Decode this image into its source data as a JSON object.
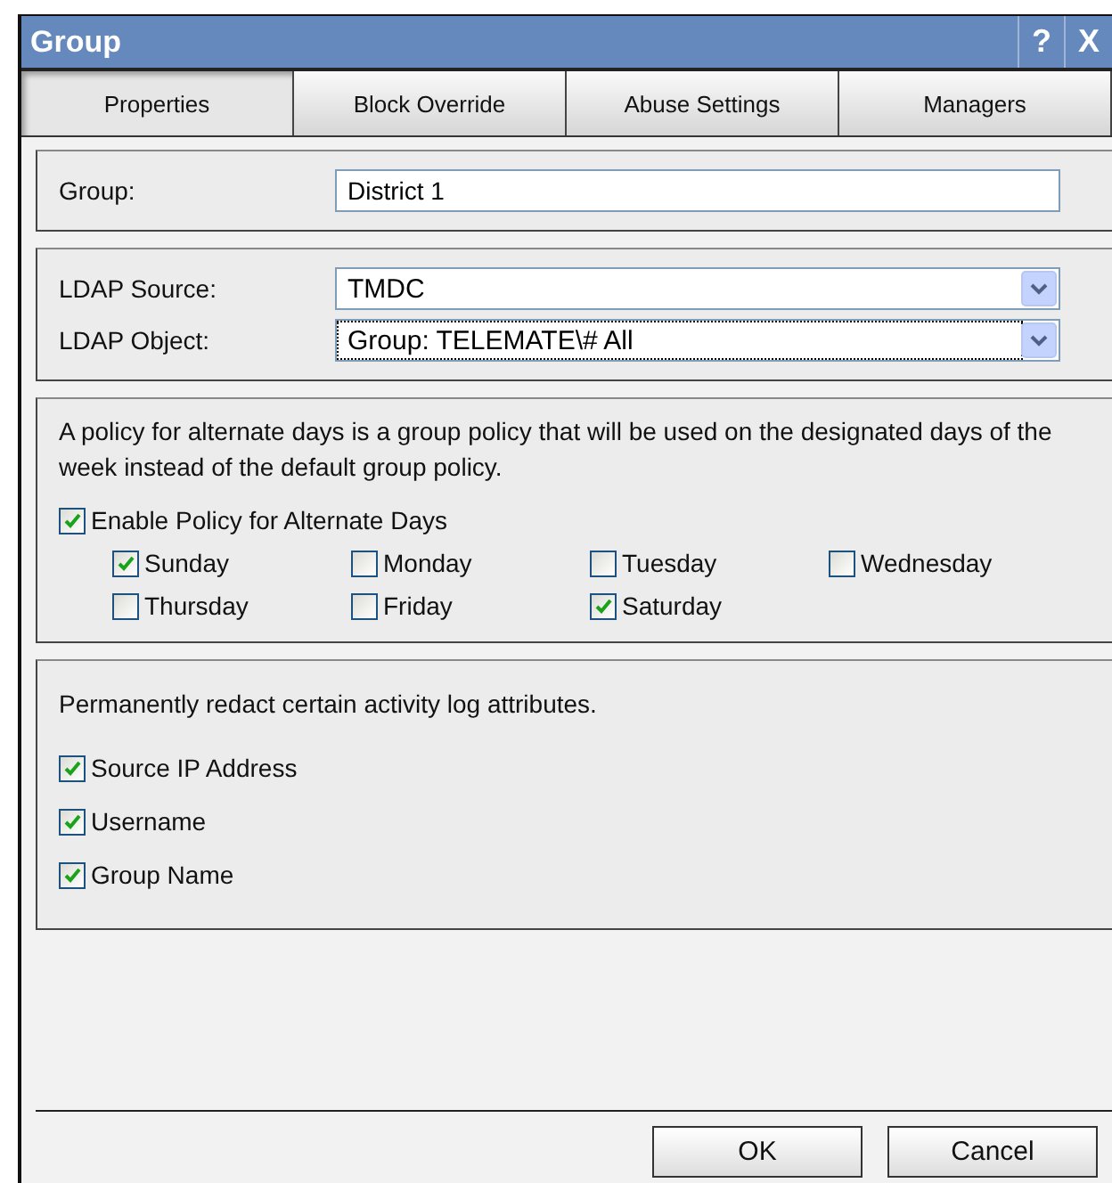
{
  "window": {
    "title": "Group",
    "help": "?",
    "close": "X"
  },
  "tabs": [
    {
      "label": "Properties",
      "selected": true
    },
    {
      "label": "Block Override",
      "selected": false
    },
    {
      "label": "Abuse Settings",
      "selected": false
    },
    {
      "label": "Managers",
      "selected": false
    }
  ],
  "group": {
    "label": "Group:",
    "value": "District 1"
  },
  "ldap": [
    {
      "label": "LDAP Source:",
      "value": "TMDC",
      "focused": false
    },
    {
      "label": "LDAP Object:",
      "value": "Group: TELEMATE\\# All",
      "focused": true
    }
  ],
  "alternate_days": {
    "description": "A policy for alternate days is a group policy that will be used on the designated days of the week instead of the default group policy.",
    "enable": {
      "label": "Enable Policy for Alternate Days",
      "checked": true
    },
    "days": [
      {
        "label": "Sunday",
        "checked": true
      },
      {
        "label": "Monday",
        "checked": false
      },
      {
        "label": "Tuesday",
        "checked": false
      },
      {
        "label": "Wednesday",
        "checked": false
      },
      {
        "label": "Thursday",
        "checked": false
      },
      {
        "label": "Friday",
        "checked": false
      },
      {
        "label": "Saturday",
        "checked": true
      }
    ]
  },
  "redact": {
    "description": "Permanently redact certain activity log attributes.",
    "options": [
      {
        "label": "Source IP Address",
        "checked": true
      },
      {
        "label": "Username",
        "checked": true
      },
      {
        "label": "Group Name",
        "checked": true
      }
    ]
  },
  "buttons": [
    "OK",
    "Cancel"
  ]
}
